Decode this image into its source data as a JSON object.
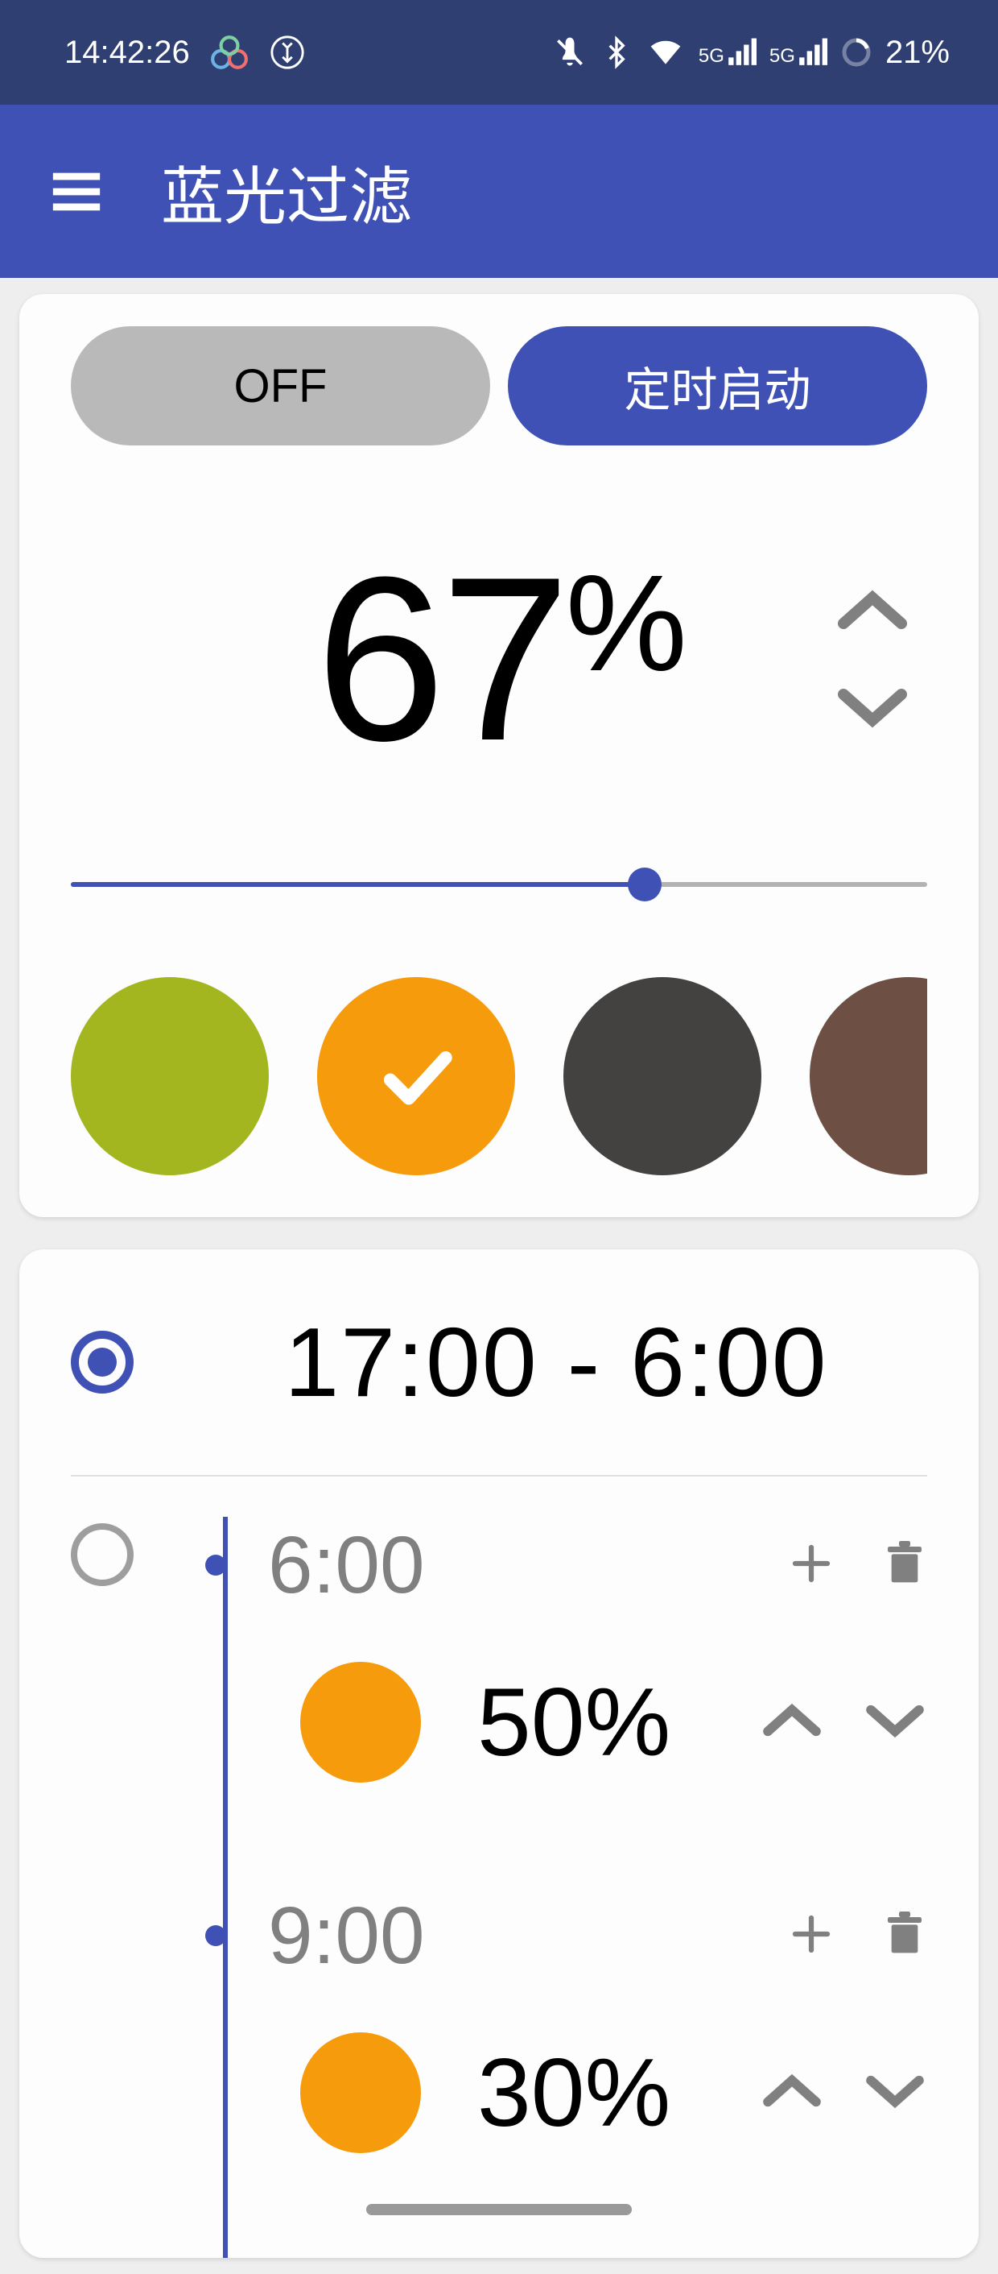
{
  "status": {
    "time": "14:42:26",
    "battery": "21%",
    "signal1": "5G",
    "signal2": "5G"
  },
  "header": {
    "title": "蓝光过滤"
  },
  "filter": {
    "off_label": "OFF",
    "schedule_label": "定时启动",
    "value": "67",
    "unit": "%",
    "slider_pct": 67,
    "colors": [
      {
        "hex": "#a3b51f",
        "selected": false
      },
      {
        "hex": "#f59b0c",
        "selected": true
      },
      {
        "hex": "#444241",
        "selected": false
      },
      {
        "hex": "#6d4f43",
        "selected": false
      },
      {
        "hex": "#d92323",
        "selected": false
      }
    ]
  },
  "schedules": [
    {
      "selected": true,
      "range": "17:00  -  6:00"
    },
    {
      "selected": false,
      "steps": [
        {
          "time": "6:00",
          "color": "#f59b0c",
          "pct": "50%"
        },
        {
          "time": "9:00",
          "color": "#f59b0c",
          "pct": "30%"
        }
      ]
    }
  ]
}
